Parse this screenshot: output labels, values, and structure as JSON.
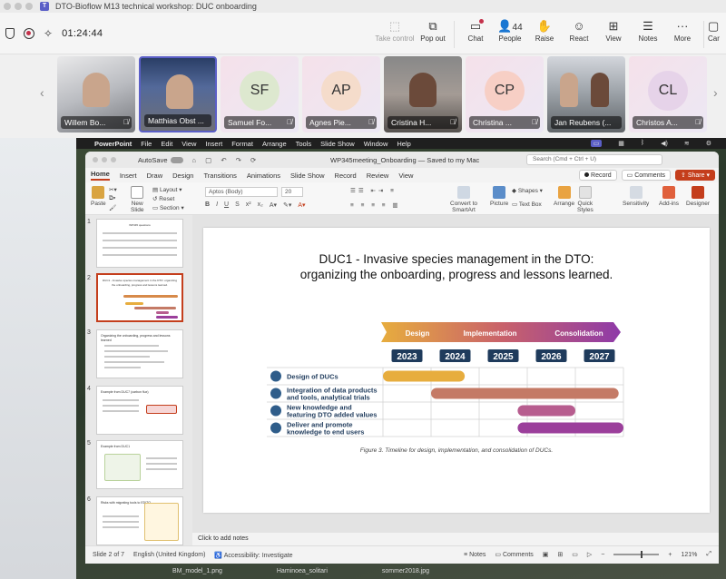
{
  "window": {
    "title": "DTO-Bioflow M13 technical workshop: DUC onboarding"
  },
  "meeting": {
    "timer": "01:24:44",
    "toolbar": [
      {
        "name": "take-control-button",
        "label": "Take control",
        "icon": "hand-pointer-icon",
        "disabled": true
      },
      {
        "name": "pop-out-button",
        "label": "Pop out",
        "icon": "pop-out-icon"
      },
      {
        "name": "chat-button",
        "label": "Chat",
        "icon": "chat-icon"
      },
      {
        "name": "people-button",
        "label": "People",
        "icon": "people-icon",
        "count": "44"
      },
      {
        "name": "raise-button",
        "label": "Raise",
        "icon": "hand-icon"
      },
      {
        "name": "react-button",
        "label": "React",
        "icon": "smiley-icon"
      },
      {
        "name": "view-button",
        "label": "View",
        "icon": "grid-icon"
      },
      {
        "name": "notes-button",
        "label": "Notes",
        "icon": "notes-icon"
      },
      {
        "name": "more-button",
        "label": "More",
        "icon": "more-icon"
      },
      {
        "name": "camera-button",
        "label": "Car",
        "icon": "camera-icon"
      }
    ]
  },
  "participants": [
    {
      "name": "Willem Bo...",
      "type": "video",
      "variant": "v1"
    },
    {
      "name": "Matthias Obst ...",
      "type": "video",
      "variant": "v2"
    },
    {
      "name": "Samuel Fo...",
      "type": "avatar",
      "initials": "SF",
      "color": "#dde8cf"
    },
    {
      "name": "Agnes Pie...",
      "type": "avatar",
      "initials": "AP",
      "color": "#f5dccb"
    },
    {
      "name": "Cristina H...",
      "type": "video",
      "variant": "v3"
    },
    {
      "name": "Christina ...",
      "type": "avatar",
      "initials": "CP",
      "color": "#f7cfc5"
    },
    {
      "name": "Jan Reubens (...",
      "type": "video",
      "variant": "v4"
    },
    {
      "name": "Christos A...",
      "type": "avatar",
      "initials": "CL",
      "color": "#e6d3e9"
    }
  ],
  "macos": {
    "app": "PowerPoint",
    "menus": [
      "File",
      "Edit",
      "View",
      "Insert",
      "Format",
      "Arrange",
      "Tools",
      "Slide Show",
      "Window",
      "Help"
    ]
  },
  "ppt": {
    "autosave": "AutoSave",
    "doc_name": "WP345meeting_Onboarding — Saved to my Mac",
    "search": "Search (Cmd + Ctrl + U)",
    "tabs": [
      "Home",
      "Insert",
      "Draw",
      "Design",
      "Transitions",
      "Animations",
      "Slide Show",
      "Record",
      "Review",
      "View"
    ],
    "record_label": "Record",
    "comments_label": "Comments",
    "share_label": "Share",
    "ribbon": {
      "paste": "Paste",
      "new_slide_line1": "New",
      "new_slide_line2": "Slide",
      "layout": "Layout",
      "reset": "Reset",
      "section": "Section",
      "font": "Aptos (Body)",
      "size": "20",
      "convert_smartart_line1": "Convert to",
      "convert_smartart_line2": "SmartArt",
      "picture": "Picture",
      "shapes": "Shapes",
      "text_box": "Text Box",
      "arrange": "Arrange",
      "quick_styles_line1": "Quick",
      "quick_styles_line2": "Styles",
      "sensitivity": "Sensitivity",
      "addins": "Add-ins",
      "designer": "Designer"
    },
    "thumbnails": [
      {
        "num": "1",
        "title": "WP345 questions"
      },
      {
        "num": "2",
        "title": "DUC1 - Invasive species management in the DTO: organizing the onboarding, progress and lessons learned."
      },
      {
        "num": "3",
        "title": "Organizing the onboarding, progress and lessons learned"
      },
      {
        "num": "4",
        "title": "Example from DUC7 (carbon flux)"
      },
      {
        "num": "5",
        "title": "Example from DUC1"
      },
      {
        "num": "6",
        "title": "Risks with migrating tools to EDITO"
      }
    ],
    "slide": {
      "title_line1": "DUC1 - Invasive species management in the DTO:",
      "title_line2": "organizing the onboarding, progress and lessons learned.",
      "phases": [
        "Design",
        "Implementation",
        "Consolidation"
      ],
      "years": [
        "2023",
        "2024",
        "2025",
        "2026",
        "2027"
      ],
      "rows": [
        {
          "label_line1": "Design of DUCs",
          "label_line2": "",
          "start": 2023.0,
          "end": 2024.7,
          "color": "#e7ad3e"
        },
        {
          "label_line1": "Integration of data products",
          "label_line2": "and tools, analytical trials",
          "start": 2024.0,
          "end": 2027.9,
          "color": "#c47a66"
        },
        {
          "label_line1": "New knowledge and",
          "label_line2": "featuring DTO added values",
          "start": 2025.8,
          "end": 2027.0,
          "color": "#b75d8f"
        },
        {
          "label_line1": "Deliver and promote",
          "label_line2": "knowledge to end users",
          "start": 2025.8,
          "end": 2028.0,
          "color": "#9b3f9b"
        }
      ],
      "caption": "Figure 3. Timeline for design, implementation, and consolidation of DUCs."
    },
    "notes_placeholder": "Click to add notes",
    "status": {
      "slide": "Slide 2 of 7",
      "language": "English (United Kingdom)",
      "accessibility": "Accessibility: Investigate",
      "notes": "Notes",
      "comments": "Comments",
      "zoom": "121%"
    }
  },
  "desktop_files": [
    "BM_model_1.png",
    "Haminoea_solitari",
    "sommer2018.jpg"
  ]
}
